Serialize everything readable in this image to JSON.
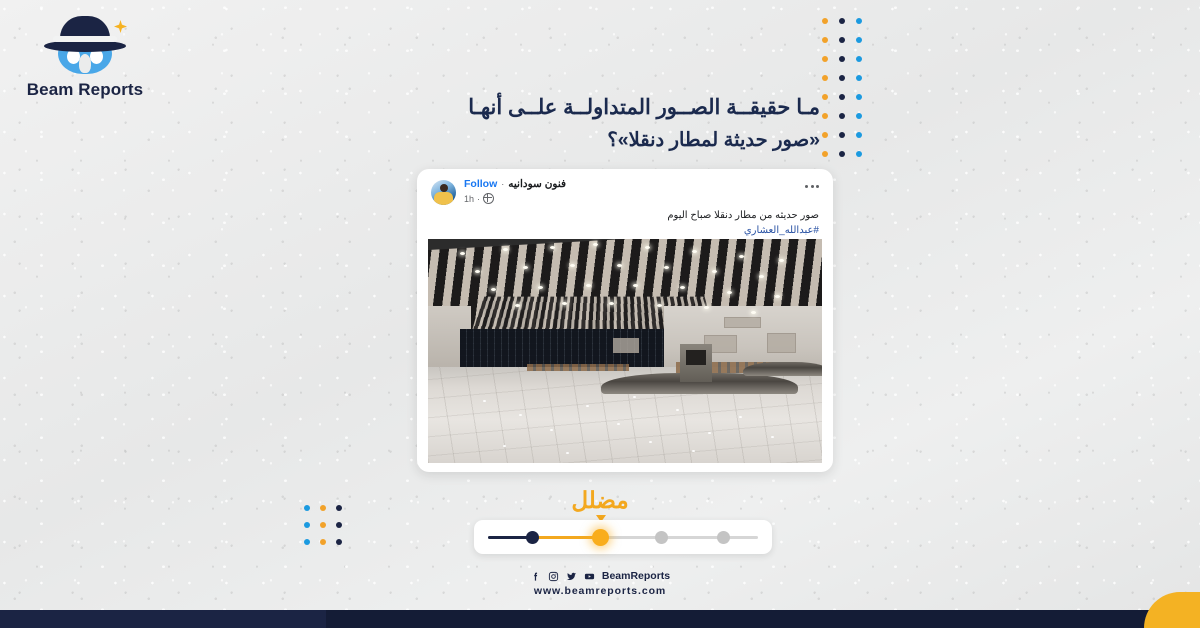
{
  "brand": {
    "name": "Beam Reports",
    "logo_icon": "detective-hat-logo",
    "colors": {
      "navy": "#1b2444",
      "orange": "#f3a81f",
      "blue": "#1b9ae0",
      "background": "#ebecec"
    }
  },
  "headline": {
    "line1": "مـا حقيقــة الصــور المتداولــة علــى أنهـا",
    "line2": "«صور حديثة لمطار دنقلا»؟"
  },
  "post": {
    "account_name": "فنون سودانيه",
    "separator": "·",
    "follow_label": "Follow",
    "timestamp": "1h",
    "meta_separator": "·",
    "audience_icon": "globe-icon",
    "more_icon": "more-options-icon",
    "avatar_icon": "profile-avatar",
    "text": "صور حديثه من مطار دنقلا صباح اليوم",
    "hashtag": "#عبدالله_العشاري",
    "photo_alt": "صالة استلام الحقائب بمطار - أرضية رخامية لامعة وسقف مشرّح"
  },
  "verdict": {
    "label": "مضلل",
    "caret_icon": "caret-down-icon",
    "scale": {
      "steps": 4,
      "active_index": 1,
      "step_colors": [
        "#1b2444",
        "#f9ad1c",
        "#c4c4c4",
        "#c4c4c4"
      ]
    }
  },
  "footer": {
    "social_icons": [
      "facebook-icon",
      "instagram-icon",
      "twitter-icon",
      "youtube-icon"
    ],
    "handle": "BeamReports",
    "website": "www.beamreports.com"
  },
  "decor": {
    "dots_right": {
      "rows": 8,
      "columns": [
        "#f2a22a",
        "#1b2444",
        "#1b9ae0"
      ]
    },
    "dots_left": {
      "rows": 3,
      "columns": [
        "#1b9ae0",
        "#f2a22a",
        "#1b2444"
      ]
    },
    "bottom_bar_color": "#1b2444",
    "corner_accent_color": "#f4b223"
  }
}
